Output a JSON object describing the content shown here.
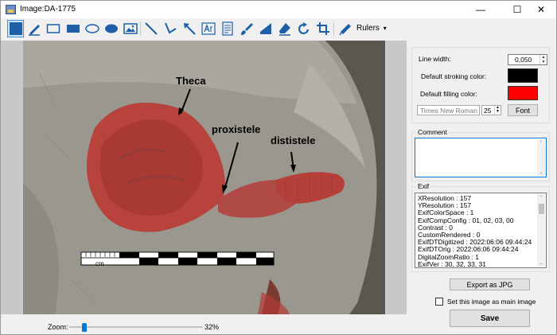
{
  "window": {
    "title": "Image:DA-1775",
    "controls": {
      "minimize": "—",
      "maximize": "☐",
      "close": "✕"
    }
  },
  "toolbar": {
    "tools": [
      {
        "icon": "selection-rectangle-icon",
        "selected": true
      },
      {
        "icon": "pen-icon"
      },
      {
        "icon": "rectangle-outline-icon"
      },
      {
        "icon": "rectangle-filled-icon"
      },
      {
        "icon": "ellipse-outline-icon"
      },
      {
        "icon": "ellipse-filled-icon"
      },
      {
        "icon": "image-icon"
      },
      {
        "icon": "line-icon"
      },
      {
        "icon": "polyline-icon"
      },
      {
        "icon": "arrow-icon"
      },
      {
        "icon": "text-box-icon"
      },
      {
        "icon": "notes-icon"
      },
      {
        "icon": "brush-icon"
      },
      {
        "icon": "fill-shape-icon"
      },
      {
        "icon": "eraser-icon"
      },
      {
        "icon": "rotate-icon"
      },
      {
        "icon": "crop-icon"
      },
      {
        "icon": "ruler-pen-icon"
      }
    ],
    "rulers_label": "Rulers",
    "rulers_caret": "▾"
  },
  "image": {
    "labels": {
      "theca": "Theca",
      "proxistele": "proxistele",
      "dististele": "dististele",
      "scale_unit": "cm"
    }
  },
  "zoom": {
    "label": "Zoom:",
    "value": "32%",
    "level": 0.1
  },
  "properties": {
    "line_width_label": "Line width:",
    "line_width_value": "0,050",
    "stroke_color_label": "Default stroking color:",
    "stroke_color": "#000000",
    "fill_color_label": "Default filling color:",
    "fill_color": "#ff0000",
    "font_name": "Times New Roman",
    "font_size": "25",
    "font_button": "Font"
  },
  "comment": {
    "title": "Comment",
    "value": ""
  },
  "exif": {
    "title": "Exif",
    "lines": [
      "XResolution :  157",
      "YResolution :  157",
      "ExifColorSpace :  1",
      "ExifCompConfig : 01, 02, 03, 00",
      "Contrast :  0",
      "CustomRendered :  0",
      "ExifDTDigitized :  2022:06:06 09:44:24",
      "ExifDTOrig :  2022:06:06 09:44:24",
      "DigitalZoomRatio :  1",
      "ExifVer :  30, 32, 33, 31"
    ]
  },
  "actions": {
    "export_label": "Export as JPG",
    "main_image_label": "Set this image as main image",
    "save_label": "Save"
  }
}
